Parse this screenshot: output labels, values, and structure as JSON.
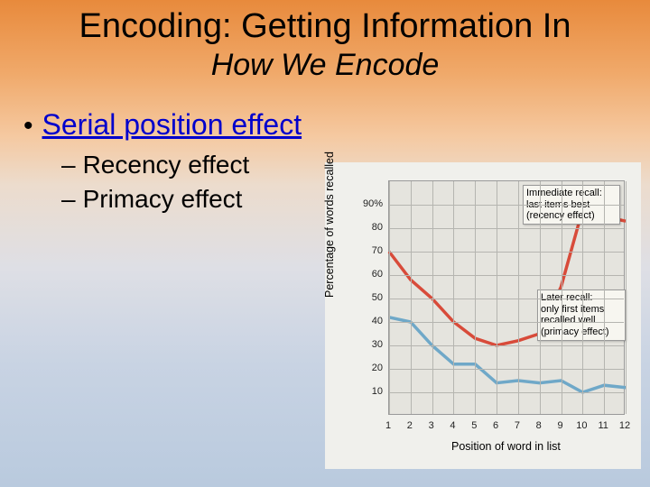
{
  "title": "Encoding: Getting Information In",
  "subtitle": "How We Encode",
  "bullet": {
    "main": "Serial position effect",
    "sub1": "Recency effect",
    "sub2": "Primacy effect"
  },
  "chart_data": {
    "type": "line",
    "xlabel": "Position of word in list",
    "ylabel": "Percentage of words recalled",
    "ylim": [
      0,
      100
    ],
    "xlim": [
      1,
      12
    ],
    "categories": [
      1,
      2,
      3,
      4,
      5,
      6,
      7,
      8,
      9,
      10,
      11,
      12
    ],
    "yticks": [
      "90%",
      "80",
      "70",
      "60",
      "50",
      "40",
      "30",
      "20",
      "10"
    ],
    "yvalues": [
      90,
      80,
      70,
      60,
      50,
      40,
      30,
      20,
      10
    ],
    "series": [
      {
        "name": "Immediate recall",
        "color": "#d84b3a",
        "values": [
          70,
          58,
          50,
          40,
          33,
          30,
          32,
          35,
          55,
          88,
          85,
          83
        ]
      },
      {
        "name": "Later recall",
        "color": "#6fa8c8",
        "values": [
          42,
          40,
          30,
          22,
          22,
          14,
          15,
          14,
          15,
          10,
          13,
          12
        ]
      }
    ],
    "annotations": [
      {
        "text_lines": [
          "Immediate recall:",
          "last items best",
          "(recency effect)"
        ]
      },
      {
        "text_lines": [
          "Later recall:",
          "only first items",
          "recalled well",
          "(primacy effect)"
        ]
      }
    ]
  }
}
